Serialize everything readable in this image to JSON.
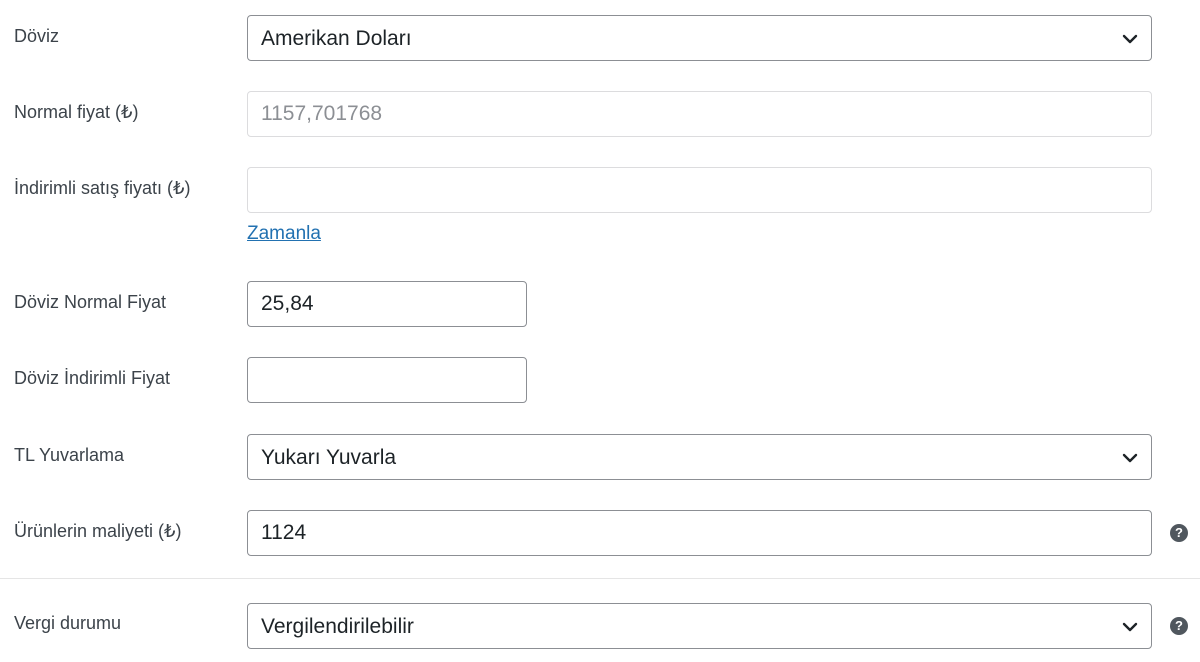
{
  "fields": {
    "currency": {
      "label": "Döviz",
      "value": "Amerikan Doları"
    },
    "regular_price": {
      "label": "Normal fiyat (₺)",
      "value": "1157,701768"
    },
    "sale_price": {
      "label": "İndirimli satış fiyatı (₺)",
      "value": "",
      "schedule_link": "Zamanla"
    },
    "currency_regular_price": {
      "label": "Döviz Normal Fiyat",
      "value": "25,84"
    },
    "currency_sale_price": {
      "label": "Döviz İndirimli Fiyat",
      "value": ""
    },
    "tl_rounding": {
      "label": "TL Yuvarlama",
      "value": "Yukarı Yuvarla"
    },
    "cost_of_goods": {
      "label": "Ürünlerin maliyeti (₺)",
      "value": "1124",
      "help": "?"
    },
    "tax_status": {
      "label": "Vergi durumu",
      "value": "Vergilendirilebilir",
      "help": "?"
    }
  },
  "icons": {
    "dropdown": "chevron-down-icon",
    "help": "help-circle-icon"
  },
  "colors": {
    "label": "#3c434a",
    "link": "#2271b1",
    "border": "#8c8f94",
    "readonly_border": "#dcdcde",
    "help_bg": "#50575e"
  }
}
